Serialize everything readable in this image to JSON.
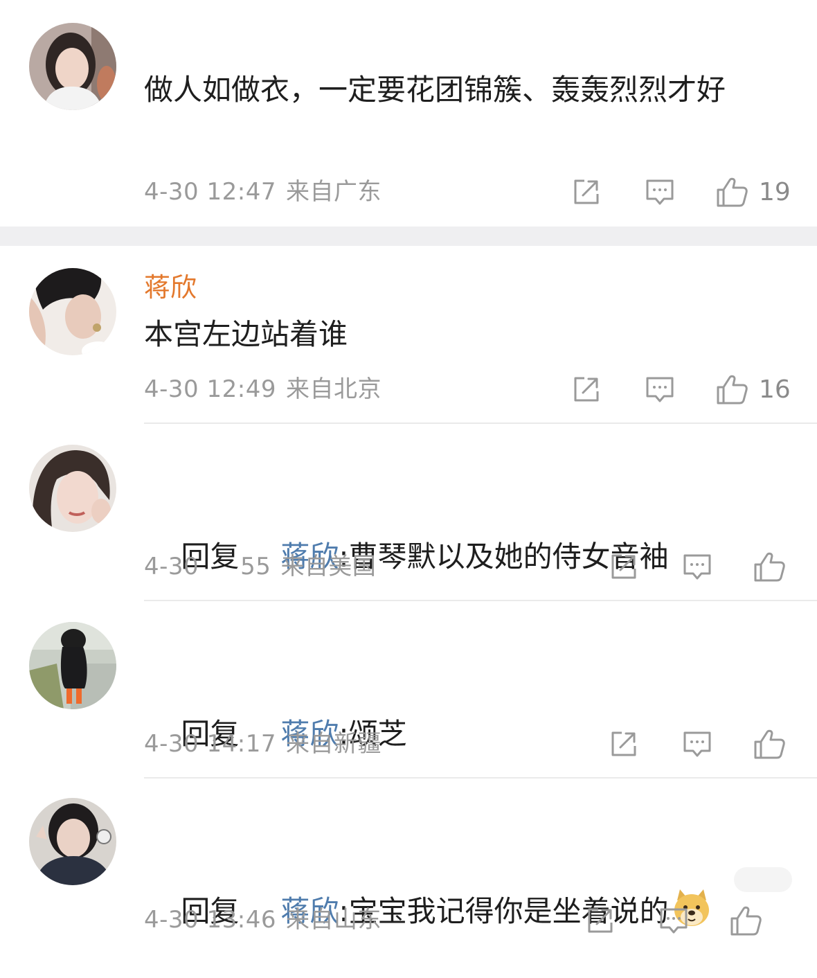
{
  "comments": [
    {
      "username": "",
      "text": "做人如做衣，一定要花团锦簇、轰轰烈烈才好",
      "time": "4-30 12:47",
      "location": "来自广东",
      "likes": "19"
    },
    {
      "username": "蒋欣",
      "text": "本宫左边站着谁",
      "time": "4-30 12:49",
      "location": "来自北京",
      "likes": "16"
    },
    {
      "reply_prefix": "回复",
      "mention": "蒋欣",
      "text": ":曹琴默以及她的侍女音袖",
      "time": "4-30",
      "time_partial": "55",
      "location": "来自美国",
      "likes": ""
    },
    {
      "reply_prefix": "回复",
      "mention": "蒋欣",
      "text": ":颂芝",
      "time": "4-30 14:17",
      "location": "来自新疆",
      "likes": ""
    },
    {
      "reply_prefix": "回复",
      "mention": "蒋欣",
      "text": ":宝宝我记得你是坐着说的",
      "emoji": "doge-emoji",
      "time": "4-30 13:46",
      "location": "来自山东",
      "likes": ""
    }
  ],
  "icons": {
    "forward": "share-icon",
    "comment": "comment-icon",
    "like": "thumbs-up-icon"
  },
  "colors": {
    "username": "#e3782c",
    "mention": "#4f7cad",
    "meta": "#9a9a9a",
    "icon": "#9a9a9a"
  }
}
